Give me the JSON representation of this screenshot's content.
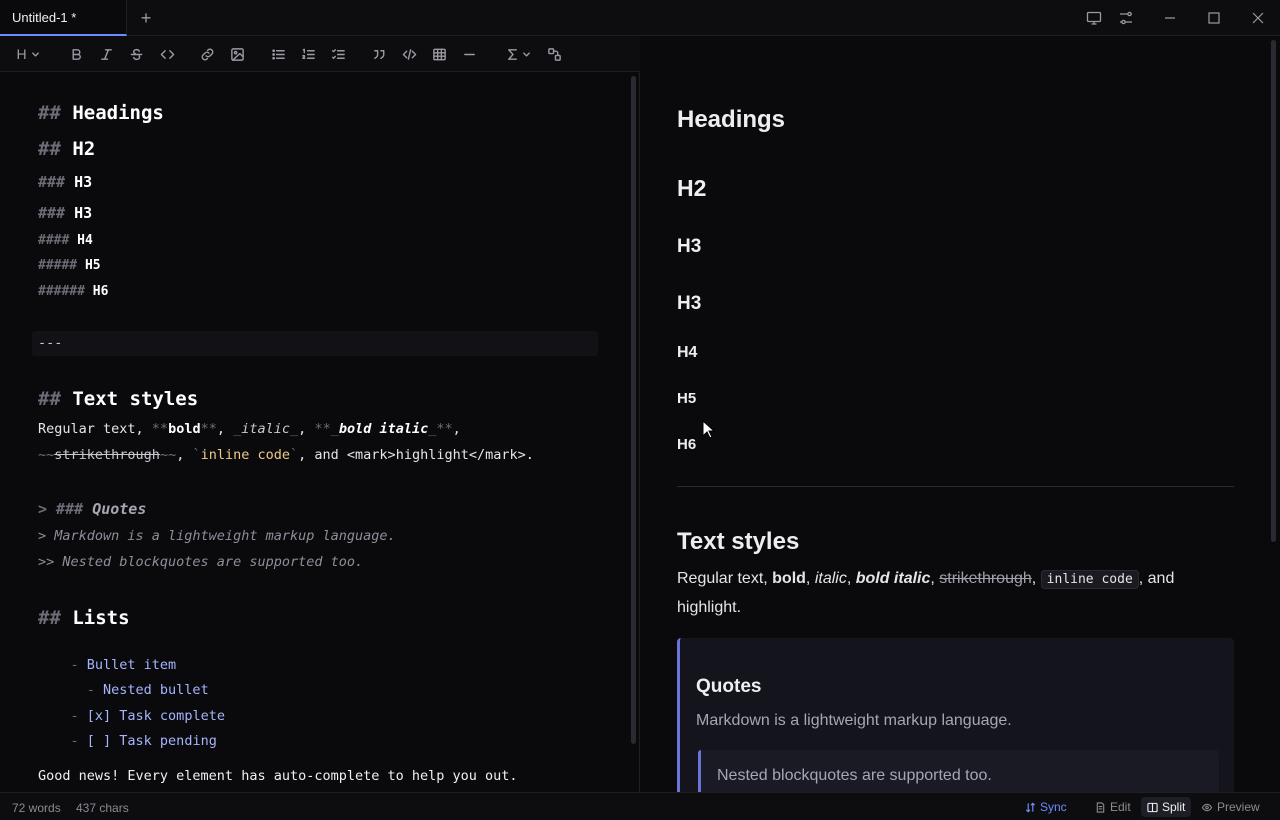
{
  "tab": {
    "title": "Untitled-1 *",
    "new_tab": "+"
  },
  "window_controls": [
    "monitor-icon",
    "sliders-icon",
    "minimize-icon",
    "maximize-icon",
    "close-icon"
  ],
  "toolbar": {
    "heading_label": "H",
    "buttons": [
      "bold",
      "italic",
      "strikethrough",
      "code",
      "link",
      "image",
      "bullet-list",
      "numbered-list",
      "task-list",
      "quote",
      "code-block",
      "table",
      "horizontal-rule",
      "math",
      "diagram"
    ]
  },
  "editor": {
    "h_headings": {
      "mk": "## ",
      "text": "Headings"
    },
    "h2": {
      "mk": "## ",
      "text": "H2"
    },
    "h3a": {
      "mk": "### ",
      "text": "H3"
    },
    "h3b": {
      "mk": "### ",
      "text": "H3"
    },
    "h4": {
      "mk": "#### ",
      "text": "H4"
    },
    "h5": {
      "mk": "##### ",
      "text": "H5"
    },
    "h6": {
      "mk": "###### ",
      "text": "H6"
    },
    "hr": "---",
    "h_text": {
      "mk": "## ",
      "text": "Text styles"
    },
    "styles1": {
      "p1": "Regular text, ",
      "m1": "**",
      "bold": "bold",
      "m2": "**",
      "p2": ", ",
      "m3": "_",
      "italic": "italic",
      "m4": "_",
      "p3": ", ",
      "m5": "**_",
      "bolditalic": "bold italic",
      "m6": "_**",
      "p4": ","
    },
    "styles2": {
      "m1": "~~",
      "strike": "strikethrough",
      "m2": "~~",
      "p1": ", ",
      "m3": "`",
      "code": "inline code",
      "m4": "`",
      "p2": ", and <mark>highlight</mark>."
    },
    "quote_head": {
      "mk": "> ### ",
      "text": "Quotes"
    },
    "quote1": "> Markdown is a lightweight markup language.",
    "quote2": ">> Nested blockquotes are supported too.",
    "h_lists": {
      "mk": "## ",
      "text": "Lists"
    },
    "list1": {
      "mk": "- ",
      "text": "Bullet item"
    },
    "list2": {
      "mk": "  - ",
      "text": "Nested bullet"
    },
    "list3": {
      "mk": "- ",
      "text": "[x] Task complete"
    },
    "list4": {
      "mk": "- ",
      "text": "[ ] Task pending"
    },
    "footer": "Good news! Every element has auto-complete to help you out."
  },
  "preview": {
    "headings": "Headings",
    "h2": "H2",
    "h3a": "H3",
    "h3b": "H3",
    "h4": "H4",
    "h5": "H5",
    "h6": "H6",
    "text_styles": "Text styles",
    "styles": {
      "p1": "Regular text, ",
      "bold": "bold",
      "p2": ", ",
      "italic": "italic",
      "p3": ", ",
      "bolditalic": "bold italic",
      "p4": ", ",
      "strike": "strikethrough",
      "p5": ", ",
      "code": "inline code",
      "p6": ", and",
      "line2": "highlight."
    },
    "quote_title": "Quotes",
    "quote_text": "Markdown is a lightweight markup language.",
    "nested_quote": "Nested blockquotes are supported too."
  },
  "status": {
    "words": "72 words",
    "chars": "437 chars",
    "sync": "Sync",
    "modes": [
      {
        "label": "Edit",
        "active": false
      },
      {
        "label": "Split",
        "active": true
      },
      {
        "label": "Preview",
        "active": false
      }
    ]
  }
}
